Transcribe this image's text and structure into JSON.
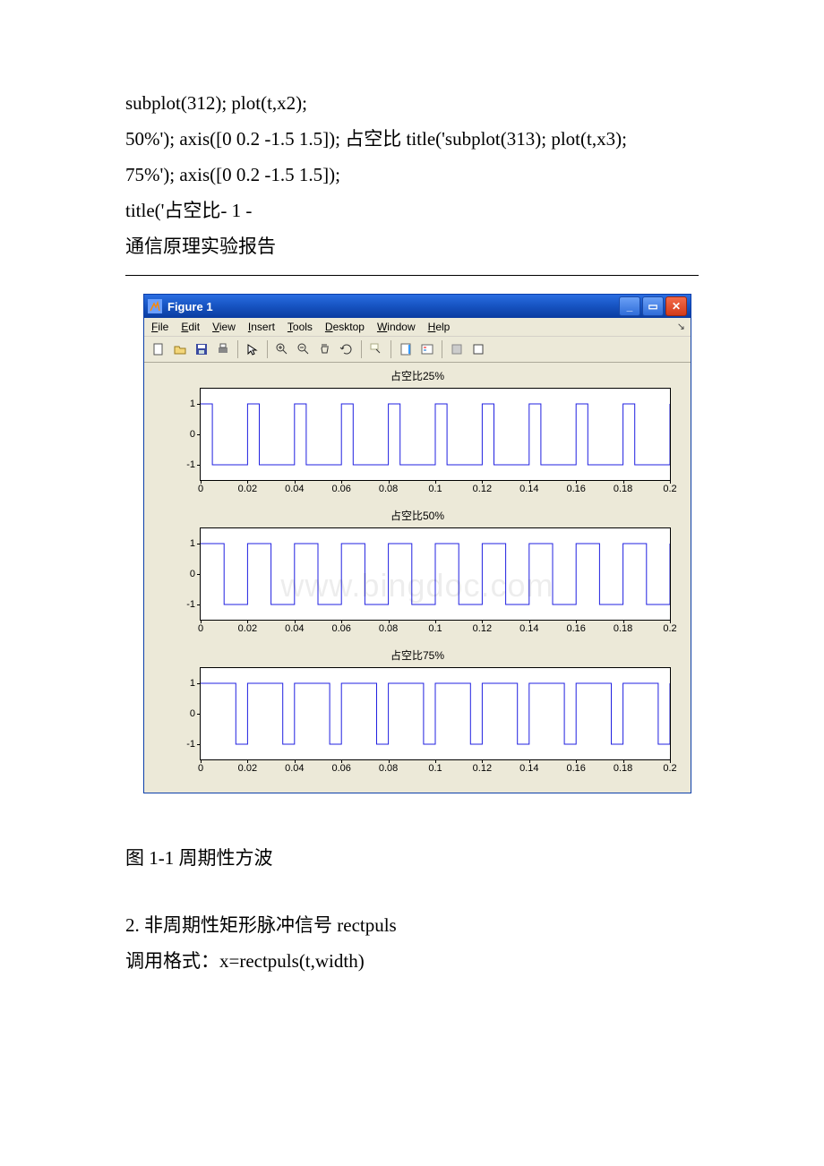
{
  "document": {
    "code_lines": [
      "subplot(312); plot(t,x2);",
      "50%'); axis([0 0.2 -1.5 1.5]); 占空比 title('subplot(313); plot(t,x3);",
      "75%'); axis([0 0.2 -1.5 1.5]);",
      "title('占空比- 1 -",
      "通信原理实验报告"
    ],
    "figure_caption": "图 1-1 周期性方波",
    "section2_title": "2. 非周期性矩形脉冲信号 rectpuls",
    "section2_line2": "调用格式：x=rectpuls(t,width)"
  },
  "window": {
    "title": "Figure 1",
    "menus": [
      "File",
      "Edit",
      "View",
      "Insert",
      "Tools",
      "Desktop",
      "Window",
      "Help"
    ],
    "toolbar_icons": [
      "new",
      "open",
      "save",
      "print",
      "arrow",
      "zoom-in",
      "zoom-out",
      "pan",
      "rotate",
      "data-cursor",
      "colorbar",
      "legend",
      "axes-grid",
      "axes-box"
    ],
    "watermark": "www.bingdoc.com"
  },
  "chart_data": [
    {
      "type": "line",
      "title": "占空比25%",
      "xlabel": "",
      "ylabel": "",
      "xlim": [
        0,
        0.2
      ],
      "ylim": [
        -1.5,
        1.5
      ],
      "xticks": [
        0,
        0.02,
        0.04,
        0.06,
        0.08,
        0.1,
        0.12,
        0.14,
        0.16,
        0.18,
        0.2
      ],
      "yticks": [
        -1,
        0,
        1
      ],
      "duty": 0.25,
      "period": 0.02,
      "amplitude": 1
    },
    {
      "type": "line",
      "title": "占空比50%",
      "xlabel": "",
      "ylabel": "",
      "xlim": [
        0,
        0.2
      ],
      "ylim": [
        -1.5,
        1.5
      ],
      "xticks": [
        0,
        0.02,
        0.04,
        0.06,
        0.08,
        0.1,
        0.12,
        0.14,
        0.16,
        0.18,
        0.2
      ],
      "yticks": [
        -1,
        0,
        1
      ],
      "duty": 0.5,
      "period": 0.02,
      "amplitude": 1
    },
    {
      "type": "line",
      "title": "占空比75%",
      "xlabel": "",
      "ylabel": "",
      "xlim": [
        0,
        0.2
      ],
      "ylim": [
        -1.5,
        1.5
      ],
      "xticks": [
        0,
        0.02,
        0.04,
        0.06,
        0.08,
        0.1,
        0.12,
        0.14,
        0.16,
        0.18,
        0.2
      ],
      "yticks": [
        -1,
        0,
        1
      ],
      "duty": 0.75,
      "period": 0.02,
      "amplitude": 1
    }
  ]
}
